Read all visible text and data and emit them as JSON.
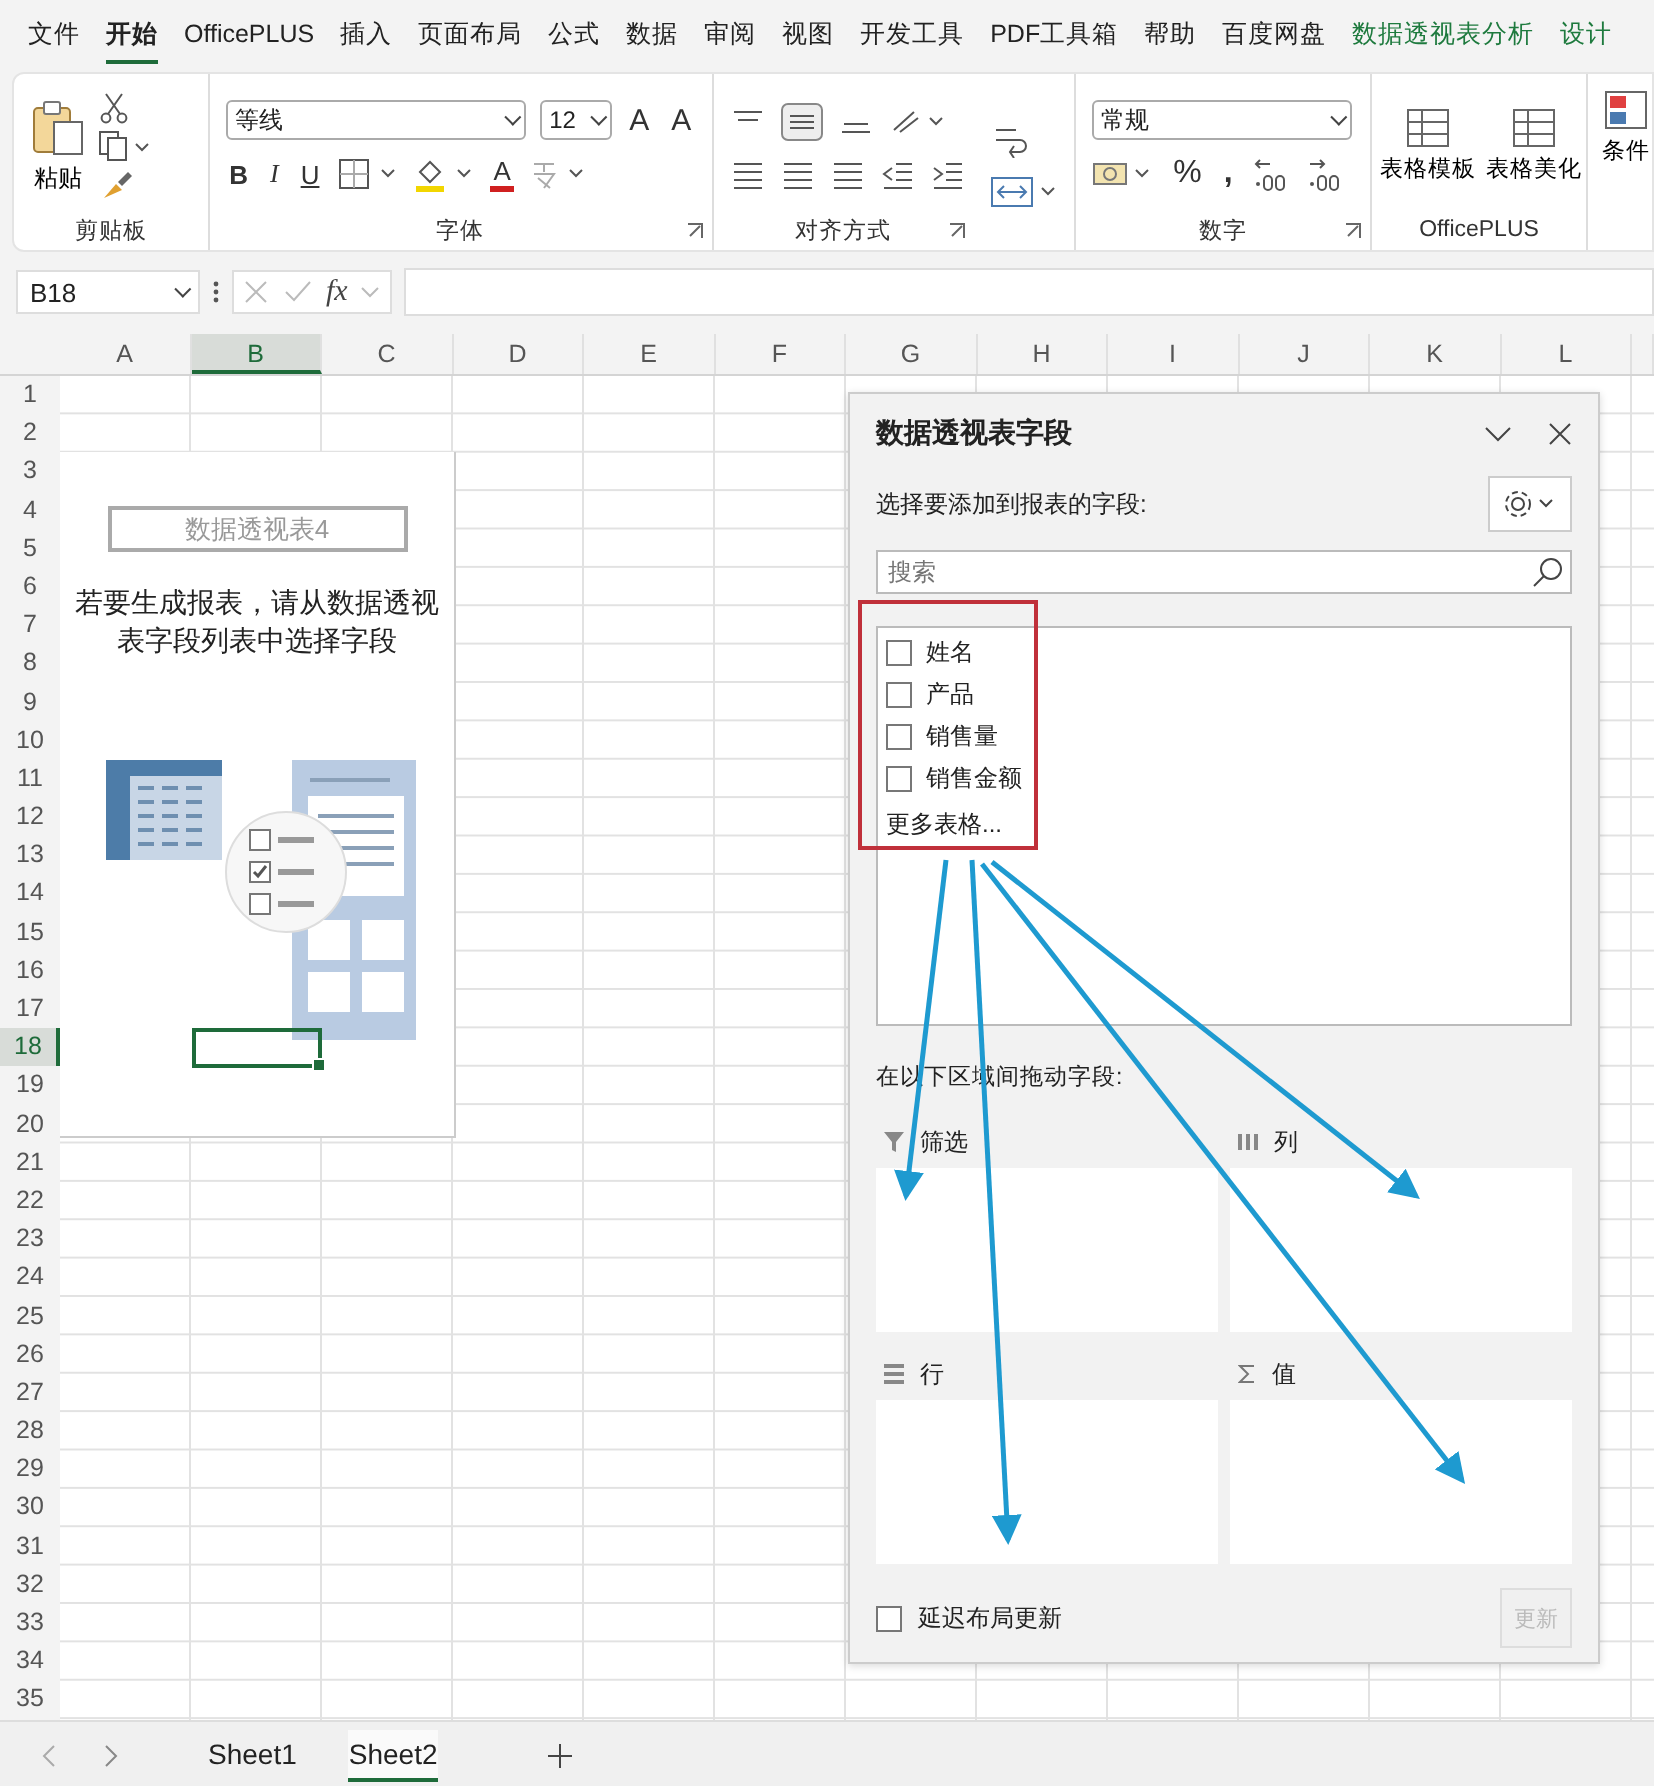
{
  "menu_tabs": [
    {
      "label": "文件",
      "selected": false,
      "kind": "normal"
    },
    {
      "label": "开始",
      "selected": true,
      "kind": "normal"
    },
    {
      "label": "OfficePLUS",
      "selected": false,
      "kind": "normal"
    },
    {
      "label": "插入",
      "selected": false,
      "kind": "normal"
    },
    {
      "label": "页面布局",
      "selected": false,
      "kind": "normal"
    },
    {
      "label": "公式",
      "selected": false,
      "kind": "normal"
    },
    {
      "label": "数据",
      "selected": false,
      "kind": "normal"
    },
    {
      "label": "审阅",
      "selected": false,
      "kind": "normal"
    },
    {
      "label": "视图",
      "selected": false,
      "kind": "normal"
    },
    {
      "label": "开发工具",
      "selected": false,
      "kind": "normal"
    },
    {
      "label": "PDF工具箱",
      "selected": false,
      "kind": "normal"
    },
    {
      "label": "帮助",
      "selected": false,
      "kind": "normal"
    },
    {
      "label": "百度网盘",
      "selected": false,
      "kind": "normal"
    },
    {
      "label": "数据透视表分析",
      "selected": false,
      "kind": "contextual"
    },
    {
      "label": "设计",
      "selected": false,
      "kind": "contextual"
    }
  ],
  "ribbon": {
    "clipboard": {
      "paste": "粘贴",
      "label": "剪贴板"
    },
    "font": {
      "name": "等线",
      "size": "12",
      "grow": "A",
      "shrink": "A",
      "bold": "B",
      "italic": "I",
      "underline": "U",
      "color_letter": "A",
      "label": "字体"
    },
    "alignment": {
      "label": "对齐方式"
    },
    "number": {
      "format": "常规",
      "percent": "%",
      "comma": ",",
      "label": "数字"
    },
    "officeplus": {
      "buttons": [
        "表格模板",
        "表格美化"
      ],
      "label": "OfficePLUS"
    },
    "partial_button": "条件"
  },
  "formula_bar": {
    "name_box": "B18",
    "fx": "fx"
  },
  "columns": [
    {
      "label": "A",
      "selected": false
    },
    {
      "label": "B",
      "selected": true
    },
    {
      "label": "C",
      "selected": false
    },
    {
      "label": "D",
      "selected": false
    },
    {
      "label": "E",
      "selected": false
    },
    {
      "label": "F",
      "selected": false
    },
    {
      "label": "G",
      "selected": false
    },
    {
      "label": "H",
      "selected": false
    },
    {
      "label": "I",
      "selected": false
    },
    {
      "label": "J",
      "selected": false
    },
    {
      "label": "K",
      "selected": false
    },
    {
      "label": "L",
      "selected": false
    }
  ],
  "rows": [
    {
      "label": "1",
      "selected": false
    },
    {
      "label": "2",
      "selected": false
    },
    {
      "label": "3",
      "selected": false
    },
    {
      "label": "4",
      "selected": false
    },
    {
      "label": "5",
      "selected": false
    },
    {
      "label": "6",
      "selected": false
    },
    {
      "label": "7",
      "selected": false
    },
    {
      "label": "8",
      "selected": false
    },
    {
      "label": "9",
      "selected": false
    },
    {
      "label": "10",
      "selected": false
    },
    {
      "label": "11",
      "selected": false
    },
    {
      "label": "12",
      "selected": false
    },
    {
      "label": "13",
      "selected": false
    },
    {
      "label": "14",
      "selected": false
    },
    {
      "label": "15",
      "selected": false
    },
    {
      "label": "16",
      "selected": false
    },
    {
      "label": "17",
      "selected": false
    },
    {
      "label": "18",
      "selected": true
    },
    {
      "label": "19",
      "selected": false
    },
    {
      "label": "20",
      "selected": false
    },
    {
      "label": "21",
      "selected": false
    },
    {
      "label": "22",
      "selected": false
    },
    {
      "label": "23",
      "selected": false
    },
    {
      "label": "24",
      "selected": false
    },
    {
      "label": "25",
      "selected": false
    },
    {
      "label": "26",
      "selected": false
    },
    {
      "label": "27",
      "selected": false
    },
    {
      "label": "28",
      "selected": false
    },
    {
      "label": "29",
      "selected": false
    },
    {
      "label": "30",
      "selected": false
    },
    {
      "label": "31",
      "selected": false
    },
    {
      "label": "32",
      "selected": false
    },
    {
      "label": "33",
      "selected": false
    },
    {
      "label": "34",
      "selected": false
    },
    {
      "label": "35",
      "selected": false
    }
  ],
  "pivot_placeholder": {
    "title": "数据透视表4",
    "message": "若要生成报表，请从数据透视表字段列表中选择字段"
  },
  "field_pane": {
    "title": "数据透视表字段",
    "subtitle": "选择要添加到报表的字段:",
    "search": {
      "placeholder": "搜索"
    },
    "fields": [
      {
        "label": "姓名",
        "checked": false
      },
      {
        "label": "产品",
        "checked": false
      },
      {
        "label": "销售量",
        "checked": false
      },
      {
        "label": "销售金额",
        "checked": false
      }
    ],
    "more": "更多表格...",
    "drag_label": "在以下区域间拖动字段:",
    "areas": [
      {
        "label": "筛选",
        "kind": "filter"
      },
      {
        "label": "列",
        "kind": "columns"
      },
      {
        "label": "行",
        "kind": "rows"
      },
      {
        "label": "值",
        "kind": "values"
      }
    ],
    "defer": {
      "label": "延迟布局更新",
      "checked": false
    },
    "update_button": {
      "label": "更新",
      "disabled": true
    }
  },
  "sheet_tabs": [
    {
      "label": "Sheet1",
      "selected": false
    },
    {
      "label": "Sheet2",
      "selected": true
    }
  ]
}
